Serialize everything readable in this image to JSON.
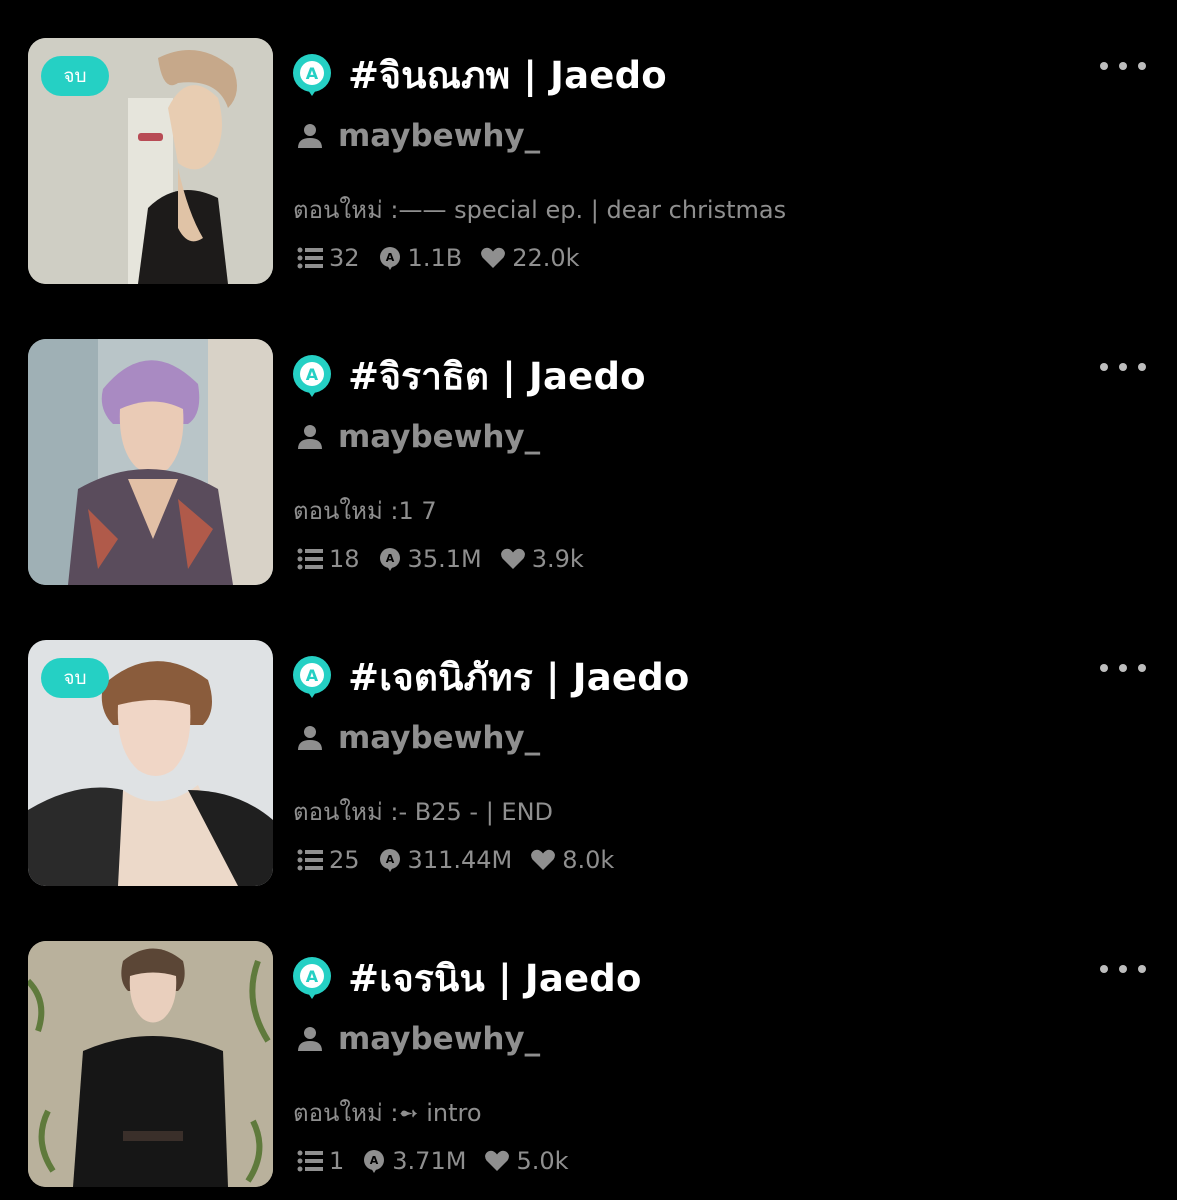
{
  "stories": [
    {
      "badge": "จบ",
      "title": "#จินณภพ | Jaedo",
      "author": "maybewhy_",
      "latest": "ตอนใหม่ :—— special ep. | dear christmas",
      "episodes": "32",
      "reads": "1.1B",
      "likes": "22.0k"
    },
    {
      "badge": "",
      "title": "#จิราธิต | Jaedo",
      "author": "maybewhy_",
      "latest": "ตอนใหม่ :1 7",
      "episodes": "18",
      "reads": "35.1M",
      "likes": "3.9k"
    },
    {
      "badge": "จบ",
      "title": "#เจตนิภัทร | Jaedo",
      "author": "maybewhy_",
      "latest": "ตอนใหม่ :- B25 - | END",
      "episodes": "25",
      "reads": "311.44M",
      "likes": "8.0k"
    },
    {
      "badge": "",
      "title": "#เจรนิน | Jaedo",
      "author": "maybewhy_",
      "latest": "ตอนใหม่ :➻ intro",
      "episodes": "1",
      "reads": "3.71M",
      "likes": "5.0k"
    }
  ],
  "colors": {
    "background": "#000000",
    "accent": "#25d0c4",
    "muted_text": "#8f8f8f",
    "title_text": "#ffffff"
  },
  "icons": {
    "app": "readawrite-a-icon",
    "author": "person-icon",
    "episodes": "list-icon",
    "reads": "views-icon",
    "likes": "heart-icon",
    "more": "more-dots-icon"
  }
}
